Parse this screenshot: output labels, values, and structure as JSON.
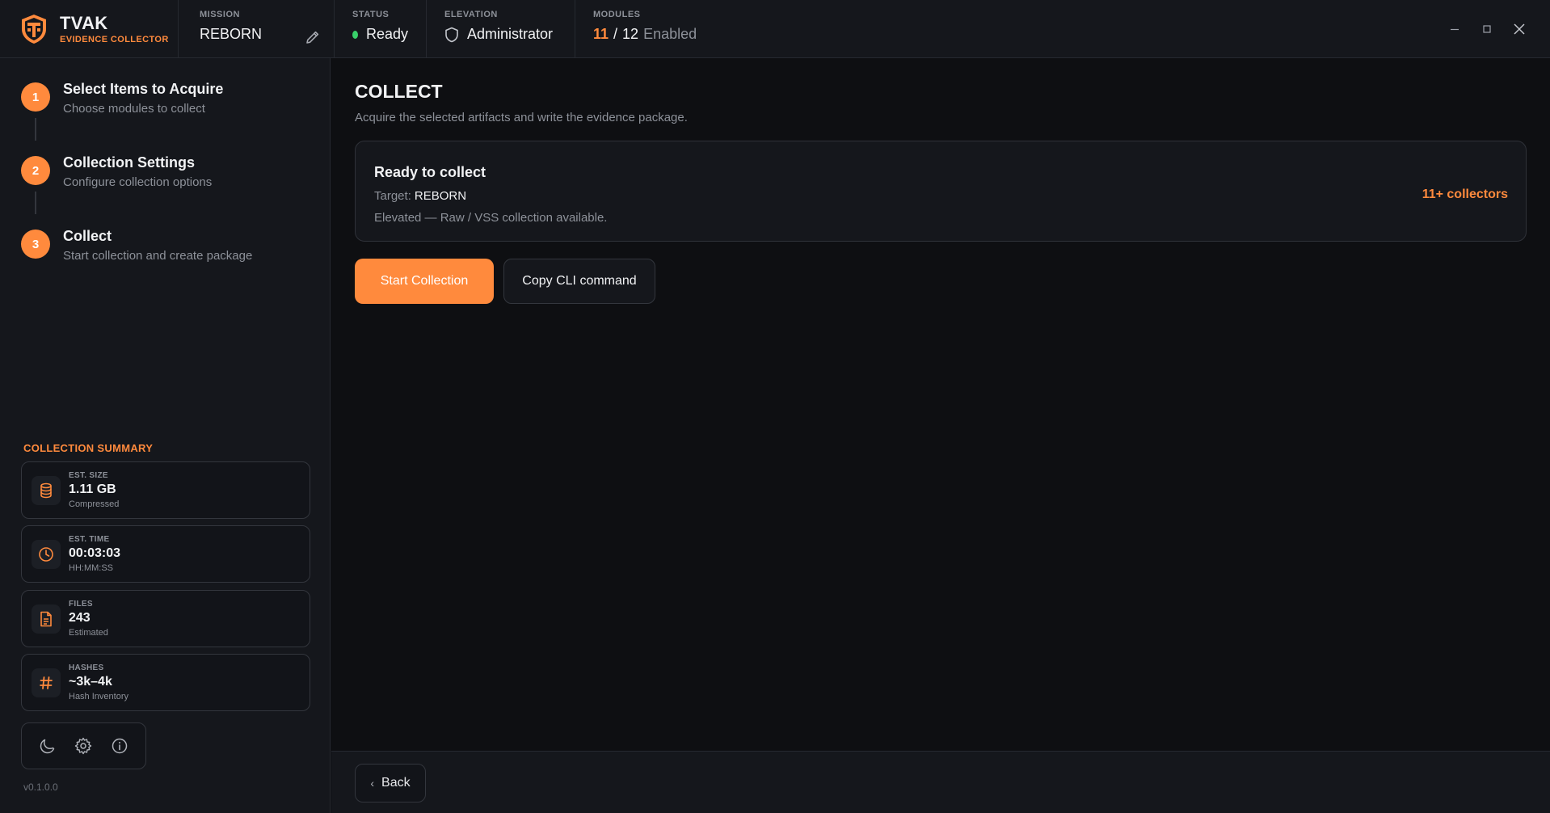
{
  "app": {
    "name": "TVAK",
    "subtitle": "EVIDENCE COLLECTOR",
    "accent_color": "#ff8a3d"
  },
  "topbar": {
    "mission": {
      "label": "MISSION",
      "value": "REBORN"
    },
    "status": {
      "label": "STATUS",
      "value": "Ready",
      "color": "#38d06a"
    },
    "elevation": {
      "label": "ELEVATION",
      "value": "Administrator"
    },
    "modules": {
      "label": "MODULES",
      "enabled": "11",
      "separator": "/",
      "total": "12",
      "suffix": "Enabled"
    }
  },
  "steps": [
    {
      "number": "1",
      "title": "Select Items to Acquire",
      "subtitle": "Choose modules to collect"
    },
    {
      "number": "2",
      "title": "Collection Settings",
      "subtitle": "Configure collection options"
    },
    {
      "number": "3",
      "title": "Collect",
      "subtitle": "Start collection and create package"
    }
  ],
  "summary": {
    "title": "COLLECTION SUMMARY",
    "items": [
      {
        "label": "EST. SIZE",
        "value": "1.11 GB",
        "sub": "Compressed",
        "icon": "database-icon"
      },
      {
        "label": "EST. TIME",
        "value": "00:03:03",
        "sub": "HH:MM:SS",
        "icon": "clock-icon"
      },
      {
        "label": "FILES",
        "value": "243",
        "sub": "Estimated",
        "icon": "file-icon"
      },
      {
        "label": "HASHES",
        "value": "~3k–4k",
        "sub": "Hash Inventory",
        "icon": "hash-icon"
      }
    ]
  },
  "version": "v0.1.0.0",
  "main": {
    "title": "COLLECT",
    "subtitle": "Acquire the selected artifacts and write the evidence package.",
    "card": {
      "title": "Ready to collect",
      "target_label": "Target:",
      "target_value": "REBORN",
      "elevation_note": "Elevated — Raw / VSS collection available.",
      "collectors": "11+ collectors"
    },
    "start_button": "Start Collection",
    "copy_button": "Copy CLI command",
    "back_button": "Back"
  }
}
